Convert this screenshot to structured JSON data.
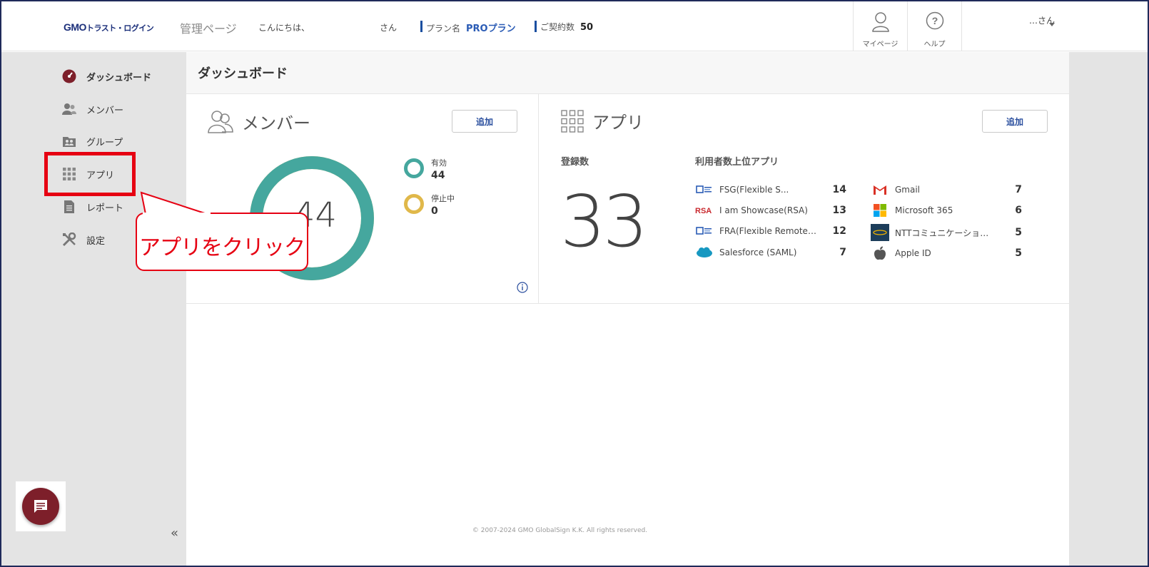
{
  "header": {
    "logo_main": "GMO",
    "logo_sub": "トラスト・ログイン",
    "title": "管理ページ",
    "greeting": "こんにちは、",
    "greeting_suffix": "さん",
    "plan_label": "プラン名",
    "plan_value": "PROプラン",
    "contract_label": "ご契約数",
    "contract_value": "50",
    "mypage_label": "マイページ",
    "help_label": "ヘルプ",
    "user_name": "…さん"
  },
  "sidebar": {
    "items": [
      {
        "label": "ダッシュボード",
        "icon": "dashboard-icon"
      },
      {
        "label": "メンバー",
        "icon": "members-icon"
      },
      {
        "label": "グループ",
        "icon": "group-icon"
      },
      {
        "label": "アプリ",
        "icon": "apps-grid-icon"
      },
      {
        "label": "レポート",
        "icon": "report-icon"
      },
      {
        "label": "設定",
        "icon": "settings-icon"
      }
    ],
    "collapse_label": "«"
  },
  "page": {
    "title": "ダッシュボード"
  },
  "member_card": {
    "title": "メンバー",
    "add_label": "追加",
    "total": "44",
    "active_fraction": 1.0,
    "legend": [
      {
        "label": "有効",
        "value": "44",
        "color": "#45a79e"
      },
      {
        "label": "停止中",
        "value": "0",
        "color": "#e0b84a"
      }
    ]
  },
  "app_card": {
    "title": "アプリ",
    "add_label": "追加",
    "registered_label": "登録数",
    "registered_value": "33",
    "top_label": "利用者数上位アプリ",
    "apps_left": [
      {
        "name": "FSG(Flexible S...",
        "count": "14",
        "icon": "fsg-icon"
      },
      {
        "name": "I am Showcase(RSA)",
        "count": "13",
        "icon": "rsa-icon"
      },
      {
        "name": "FRA(Flexible Remote Acc...",
        "count": "12",
        "icon": "fra-icon"
      },
      {
        "name": "Salesforce (SAML)",
        "count": "7",
        "icon": "salesforce-icon"
      }
    ],
    "apps_right": [
      {
        "name": "Gmail",
        "count": "7",
        "icon": "gmail-icon"
      },
      {
        "name": "Microsoft 365",
        "count": "6",
        "icon": "microsoft-icon"
      },
      {
        "name": "NTTコミュニケーション...",
        "count": "5",
        "icon": "ntt-icon"
      },
      {
        "name": "Apple ID",
        "count": "5",
        "icon": "apple-icon"
      }
    ]
  },
  "footer": {
    "copyright": "© 2007-2024 GMO GlobalSign K.K. All rights reserved."
  },
  "annotation": {
    "callout_text": "アプリをクリック",
    "color": "#e60012"
  }
}
